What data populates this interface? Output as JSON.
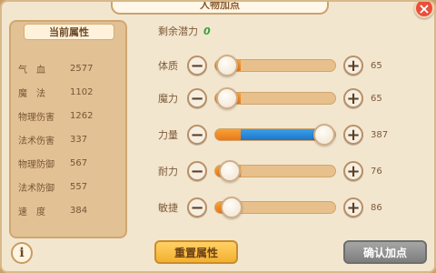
{
  "window": {
    "title": "人物加点"
  },
  "left_panel": {
    "header": "当前属性",
    "stats": [
      {
        "label": "气　血",
        "value": "2577"
      },
      {
        "label": "魔　法",
        "value": "1102"
      },
      {
        "label": "物理伤害",
        "value": "1262"
      },
      {
        "label": "法术伤害",
        "value": "337"
      },
      {
        "label": "物理防御",
        "value": "567"
      },
      {
        "label": "法术防御",
        "value": "557"
      },
      {
        "label": "速　度",
        "value": "384"
      }
    ]
  },
  "right_panel": {
    "remaining_label": "剩余潜力",
    "remaining_value": "0",
    "attributes": [
      {
        "label": "体质",
        "value": "65",
        "level": 0.1
      },
      {
        "label": "魔力",
        "value": "65",
        "level": 0.1
      },
      {
        "label": "力量",
        "value": "387",
        "level": 0.92
      },
      {
        "label": "耐力",
        "value": "76",
        "level": 0.12
      },
      {
        "label": "敏捷",
        "value": "86",
        "level": 0.14
      }
    ]
  },
  "buttons": {
    "reset": "重置属性",
    "confirm": "确认加点",
    "close_icon": "close-icon",
    "info_icon": "info-icon"
  },
  "colors": {
    "accent_blue": "#1f74c7",
    "accent_orange": "#f4b02e",
    "remaining_green": "#39a13a"
  }
}
